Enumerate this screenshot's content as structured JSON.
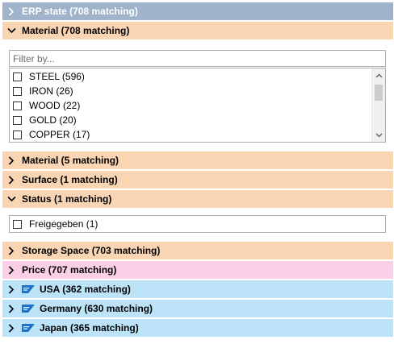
{
  "sections": {
    "erp_state": {
      "label": "ERP state (708 matching)",
      "expanded": false
    },
    "material_1": {
      "label": "Material (708 matching)",
      "expanded": true
    },
    "material_2": {
      "label": "Material (5 matching)",
      "expanded": false
    },
    "surface": {
      "label": "Surface (1 matching)",
      "expanded": false
    },
    "status": {
      "label": "Status (1 matching)",
      "expanded": true
    },
    "storage_space": {
      "label": "Storage Space (703 matching)",
      "expanded": false
    },
    "price": {
      "label": "Price (707 matching)",
      "expanded": false
    },
    "usa": {
      "label": "USA (362 matching)",
      "expanded": false,
      "icon": "sap-icon"
    },
    "germany": {
      "label": "Germany (630 matching)",
      "expanded": false,
      "icon": "sap-icon"
    },
    "japan": {
      "label": "Japan (365 matching)",
      "expanded": false,
      "icon": "sap-icon"
    }
  },
  "material_filter": {
    "placeholder": "Filter by...",
    "value": "",
    "items": [
      {
        "label": "STEEL (596)",
        "checked": false
      },
      {
        "label": "IRON (26)",
        "checked": false
      },
      {
        "label": "WOOD (22)",
        "checked": false
      },
      {
        "label": "GOLD (20)",
        "checked": false
      },
      {
        "label": "COPPER (17)",
        "checked": false
      }
    ]
  },
  "status_filter": {
    "items": [
      {
        "label": "Freigegeben (1)",
        "checked": false
      }
    ]
  },
  "colors": {
    "erp_header": "#9fb3ca",
    "orange_header": "#fad5b4",
    "pink_header": "#fbd0e6",
    "blue_header": "#bce3f8"
  }
}
